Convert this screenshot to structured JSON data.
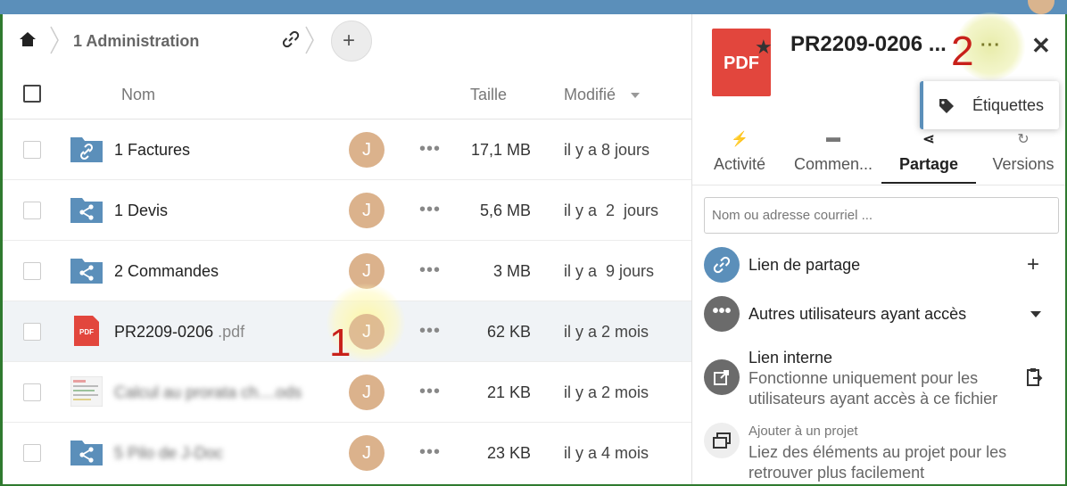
{
  "breadcrumb": {
    "folder": "1 Administration"
  },
  "table": {
    "headers": {
      "name": "Nom",
      "size": "Taille",
      "modified": "Modifié"
    },
    "rows": [
      {
        "name": "1 Factures",
        "ext": "",
        "type": "folder-link",
        "avatar": "J",
        "size": "17,1 MB",
        "modified": "il y a 8 jours"
      },
      {
        "name": "1 Devis",
        "ext": "",
        "type": "folder-shared",
        "avatar": "J",
        "size": "5,6 MB",
        "modified": "il y a  2  jours"
      },
      {
        "name": "2 Commandes",
        "ext": "",
        "type": "folder-shared",
        "avatar": "J",
        "size": "3 MB",
        "modified": "il y a  9 jours"
      },
      {
        "name": "PR2209-0206",
        "ext": " .pdf",
        "type": "pdf",
        "avatar": "J",
        "size": "62 KB",
        "modified": "il y a 2 mois"
      },
      {
        "name": "Calcul au prorata ch....ods",
        "ext": "",
        "type": "spreadsheet",
        "avatar": "J",
        "size": "21 KB",
        "modified": "il y a 2 mois"
      },
      {
        "name": "5 Pilo de J-Doc",
        "ext": "",
        "type": "folder-shared",
        "avatar": "J",
        "size": "23 KB",
        "modified": "il y a 4 mois"
      }
    ]
  },
  "annotations": {
    "step1": "1",
    "step2": "2"
  },
  "sidebar": {
    "file_icon_label": "PDF",
    "title": "PR2209-0206 ...",
    "more_label": "···",
    "close_label": "✕",
    "menu": {
      "tags_label": "Étiquettes"
    },
    "tabs": [
      "Activité",
      "Commen...",
      "Partage",
      "Versions"
    ],
    "share_placeholder": "Nom ou adresse courriel ...",
    "share_link_label": "Lien de partage",
    "share_link_add": "+",
    "other_users_label": "Autres utilisateurs ayant accès",
    "internal_link_title": "Lien interne",
    "internal_link_desc": "Fonctionne uniquement pour les utilisateurs ayant accès à ce fichier",
    "project_title": "Ajouter à un projet",
    "project_desc": "Liez des éléments au projet pour les retrouver plus facilement"
  },
  "colors": {
    "accent": "#5b8fba",
    "pdf": "#e2463d",
    "avatar": "#dbb28c",
    "annotation": "#c8201a"
  }
}
